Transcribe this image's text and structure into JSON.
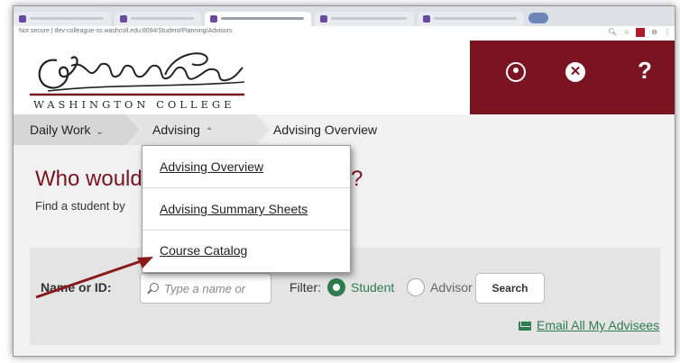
{
  "browser": {
    "url": "Not secure | dev-colleague-ss.washcoll.edu:8094/Student/Planning/Advisors"
  },
  "header": {
    "logo_wordmark": "WASHINGTON COLLEGE",
    "help_symbol": "?",
    "close_symbol": "✕"
  },
  "breadcrumb": {
    "daily_work": "Daily Work",
    "advising": "Advising",
    "current": "Advising Overview"
  },
  "main": {
    "heading_start": "Who would",
    "heading_end": "?",
    "subtext": "Find a student by"
  },
  "dropdown": {
    "items": [
      "Advising Overview",
      "Advising Summary Sheets",
      "Course Catalog"
    ]
  },
  "search": {
    "name_label": "Name or ID:",
    "name_placeholder": "Type a name or",
    "filter_label": "Filter:",
    "student_label": "Student",
    "advisor_label": "Advisor",
    "search_button": "Search",
    "email_link": "Email All My Advisees",
    "selected_filter": "Student"
  },
  "colors": {
    "brand_maroon": "#7a1420",
    "accent_green": "#2e7d4f",
    "arrow_red": "#8a1a1a"
  },
  "icons": [
    "user-icon",
    "close-circle-icon",
    "help-icon",
    "search-icon",
    "mail-icon",
    "chevron-down-icon",
    "chevron-up-icon"
  ]
}
